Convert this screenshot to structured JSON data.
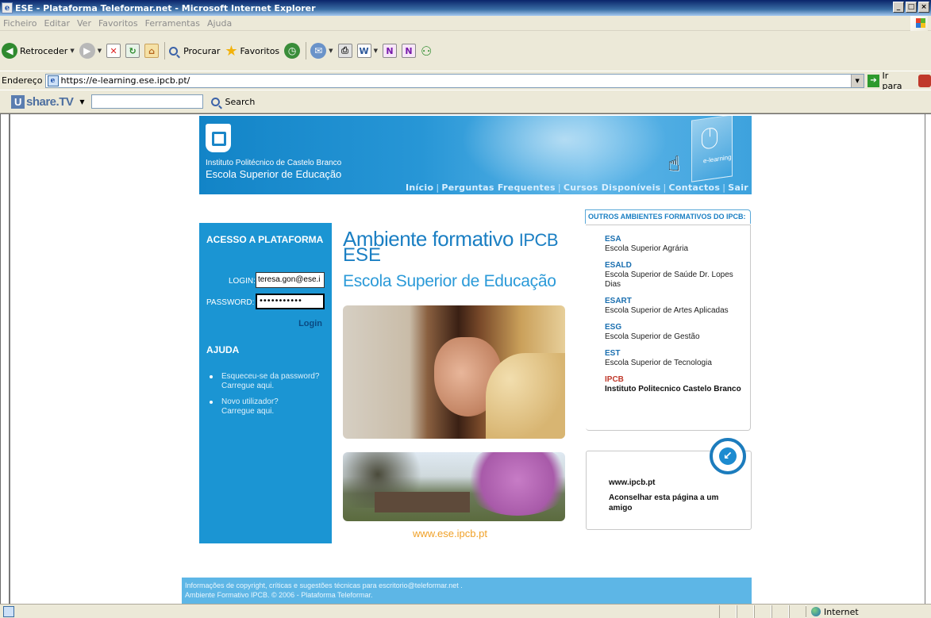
{
  "window": {
    "title": "ESE - Plataforma Teleformar.net - Microsoft Internet Explorer",
    "buttons": [
      "_",
      "□",
      "×"
    ]
  },
  "menubar": {
    "items": [
      "Ficheiro",
      "Editar",
      "Ver",
      "Favoritos",
      "Ferramentas",
      "Ajuda"
    ]
  },
  "toolbar": {
    "back_label": "Retroceder",
    "search_label": "Procurar",
    "favorites_label": "Favoritos"
  },
  "addressbar": {
    "label": "Endereço",
    "url": "https://e-learning.ese.ipcb.pt/",
    "go_label": "Ir para"
  },
  "sharebar": {
    "logo": "share.TV",
    "search_label": "Search",
    "search_value": ""
  },
  "banner": {
    "institute": "Instituto Politécnico de Castelo Branco",
    "school": "Escola Superior de Educação",
    "elearning_label": "e-learning",
    "nav": [
      "Início",
      "Perguntas Frequentes",
      "Cursos Disponíveis",
      "Contactos",
      "Sair"
    ]
  },
  "login": {
    "title": "ACESSO A PLATAFORMA",
    "login_label": "LOGIN:",
    "login_value": "teresa.gon@ese.i",
    "password_label": "PASSWORD:",
    "password_value": "•••••••••••",
    "submit_label": "Login",
    "help_title": "AJUDA",
    "help_items": [
      {
        "line1": "Esqueceu-se da password?",
        "line2": "Carregue aqui."
      },
      {
        "line1": "Novo utilizador?",
        "line2": "Carregue aqui."
      }
    ]
  },
  "center": {
    "title_main": "Ambiente formativo",
    "title_ipcb": "IPCB",
    "title_ese": "ESE",
    "subtitle": "Escola Superior de Educação",
    "site_link": "www.ese.ipcb.pt"
  },
  "others": {
    "title": "OUTROS AMBIENTES FORMATIVOS DO IPCB:",
    "schools": [
      {
        "abbr": "ESA",
        "name": "Escola Superior Agrária"
      },
      {
        "abbr": "ESALD",
        "name": "Escola Superior de Saúde Dr. Lopes Dias"
      },
      {
        "abbr": "ESART",
        "name": "Escola Superior de Artes Aplicadas"
      },
      {
        "abbr": "ESG",
        "name": "Escola Superior de Gestão"
      },
      {
        "abbr": "EST",
        "name": "Escola Superior de Tecnologia"
      },
      {
        "abbr": "IPCB",
        "name": "Instituto Politecnico Castelo Branco"
      }
    ]
  },
  "links": {
    "www": "www.ipcb.pt",
    "recommend": "Aconselhar esta página a um amigo"
  },
  "footer": {
    "line1": "Informações de copyright, críticas e sugestões técnicas para escritorio@teleformar.net .",
    "line2": "Ambiente Formativo IPCB. © 2006 - Plataforma Teleformar."
  },
  "statusbar": {
    "zone": "Internet"
  },
  "colors": {
    "brand_blue": "#1b95d3",
    "title_blue": "#1b7fc3",
    "footer_blue": "#5db6e6",
    "link_orange": "#f0a128",
    "ipcb_red": "#c0392b"
  }
}
